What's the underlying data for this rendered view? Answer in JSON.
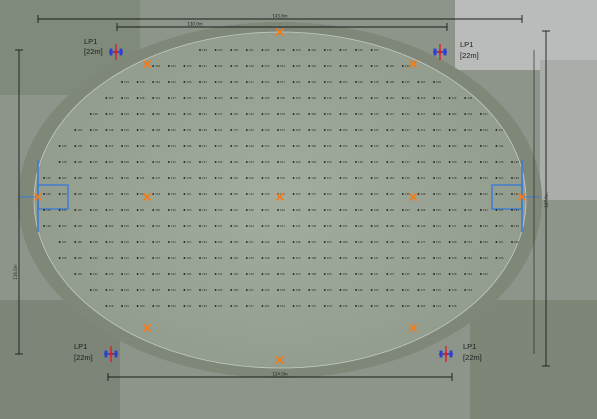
{
  "plan": {
    "poles": [
      {
        "id": "pole-top-left",
        "name": "LP1",
        "height": "[22m]"
      },
      {
        "id": "pole-top-right",
        "name": "LP1",
        "height": "[22m]"
      },
      {
        "id": "pole-bottom-left",
        "name": "LP1",
        "height": "[22m]"
      },
      {
        "id": "pole-bottom-right",
        "name": "LP1",
        "height": "[22m]"
      }
    ],
    "dimensions": {
      "top_outer": "143.6m",
      "top_inner": "130.0m",
      "bottom": "124.0m",
      "left": "116.0m",
      "right": "127.0m"
    },
    "grid_values": [
      "149",
      "153",
      "158",
      "161",
      "160",
      "156",
      "150",
      "142",
      "139",
      "147",
      "152",
      "157",
      "162",
      "164",
      "159",
      "151",
      "144",
      "138",
      "148",
      "155",
      "163",
      "168",
      "165",
      "154",
      "146",
      "141",
      "137",
      "145"
    ],
    "colors": {
      "turf": "#9aa69a",
      "marker": "#f07d1a",
      "pole_red": "#d4232a",
      "pole_blue": "#2b3fcf",
      "goal_line": "#3a7bd5",
      "dimension_line": "#1a1a1a"
    }
  }
}
